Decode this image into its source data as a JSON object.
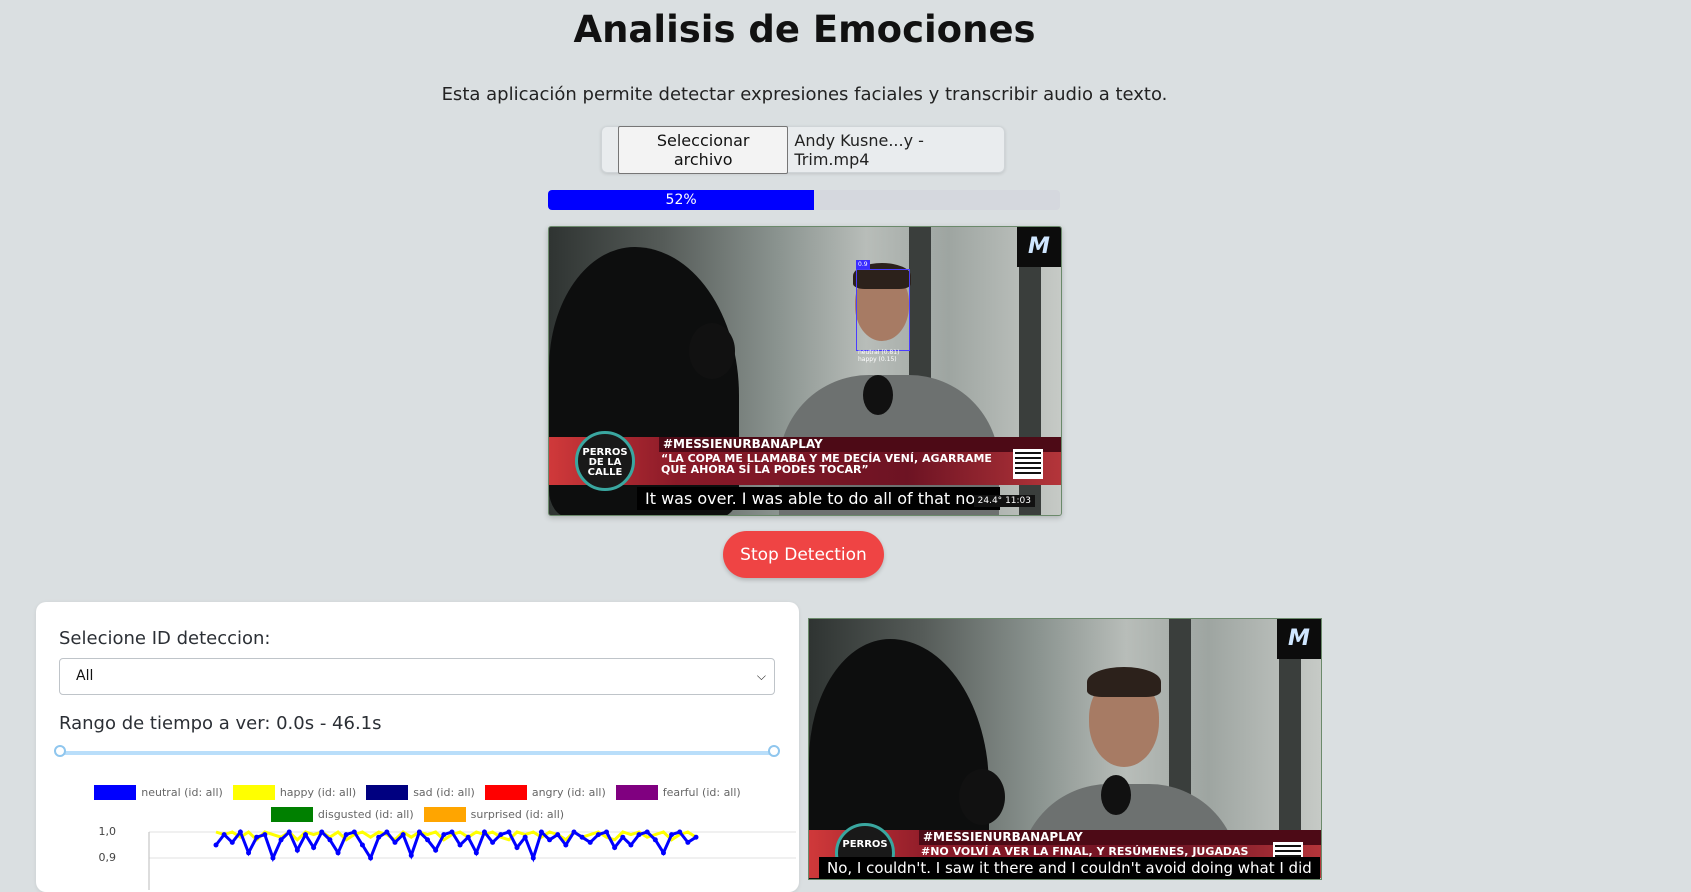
{
  "header": {
    "title": "Analisis de Emociones",
    "subtitle": "Esta aplicación permite detectar expresiones faciales y transcribir audio a texto."
  },
  "file_input": {
    "button_label": "Seleccionar archivo",
    "file_name": "Andy Kusne...y - Trim.mp4"
  },
  "progress": {
    "label": "52%",
    "value": 0.52,
    "color": "#0000ff"
  },
  "video_main": {
    "logo": "M",
    "banner_tag": "#MESSIENURBANAPLAY",
    "banner_quote": "“LA COPA ME LLAMABA Y ME DECÍA VENÍ, AGARRAME QUE AHORA SÍ LA PODES TOCAR”",
    "channel": "PERROS DE LA CALLE",
    "caption": "It was over. I was able to do all of that now.",
    "temperature": "24.4°",
    "clock": "11:03",
    "face_id": "0.9",
    "face_labels": [
      "neutral (0.81)",
      "happy (0.15)"
    ]
  },
  "video_second": {
    "logo": "M",
    "banner_tag": "#MESSIENURBANAPLAY",
    "banner_quote": "#NO VOLVÍ A VER LA FINAL, Y RESÚMENES, JUGADAS",
    "channel": "PERROS",
    "caption": "No, I couldn't. I saw it there and I couldn't avoid doing what I did"
  },
  "controls": {
    "stop_label": "Stop Detection"
  },
  "panel": {
    "select_label": "Selecione ID deteccion:",
    "select_value": "All",
    "range_label": "Rango de tiempo a ver: 0.0s - 46.1s"
  },
  "chart_data": {
    "type": "line",
    "series": [
      {
        "name": "neutral (id: all)",
        "color": "#0000ff"
      },
      {
        "name": "happy (id: all)",
        "color": "#ffff00"
      },
      {
        "name": "sad (id: all)",
        "color": "#000080"
      },
      {
        "name": "angry (id: all)",
        "color": "#ff0000"
      },
      {
        "name": "fearful (id: all)",
        "color": "#800080"
      },
      {
        "name": "disgusted (id: all)",
        "color": "#008000"
      },
      {
        "name": "surprised (id: all)",
        "color": "#ffa500"
      }
    ],
    "y_ticks": [
      "1,0",
      "0,9"
    ],
    "ylim": [
      0.85,
      1.0
    ],
    "neutral_values": [
      0.95,
      0.99,
      0.96,
      1.0,
      0.92,
      0.98,
      0.99,
      0.9,
      0.97,
      1.0,
      0.93,
      0.99,
      0.94,
      1.0,
      0.97,
      0.92,
      0.99,
      1.0,
      0.95,
      0.9,
      0.98,
      1.0,
      0.96,
      0.99,
      0.91,
      1.0,
      0.97,
      0.93,
      0.99,
      1.0,
      0.95,
      0.98,
      0.92,
      1.0,
      0.96,
      0.99,
      1.0,
      0.94,
      0.98,
      0.9,
      1.0,
      0.97,
      0.99,
      0.95,
      1.0,
      0.98,
      0.96,
      0.99,
      1.0,
      0.94,
      0.98,
      0.95,
      0.99,
      1.0,
      0.97,
      0.92,
      0.99,
      1.0,
      0.96,
      0.98
    ],
    "happy_values": [
      1.0,
      0.99,
      1.0,
      0.98,
      1.0,
      0.97,
      1.0,
      0.99,
      0.98,
      1.0,
      0.97,
      1.0,
      0.99,
      1.0,
      0.98,
      1.0,
      0.97,
      0.99,
      1.0,
      0.98,
      1.0,
      0.99,
      0.97,
      1.0,
      0.98,
      1.0,
      0.99,
      1.0,
      0.97,
      0.99,
      1.0,
      0.98,
      1.0,
      0.99,
      1.0,
      0.98,
      0.97,
      1.0,
      0.99,
      1.0,
      0.98,
      1.0,
      0.99,
      0.97,
      1.0,
      0.98,
      0.99,
      1.0,
      0.98,
      0.97,
      1.0,
      0.99,
      1.0,
      0.98,
      0.99,
      1.0,
      0.97,
      0.99,
      1.0,
      0.98
    ]
  }
}
